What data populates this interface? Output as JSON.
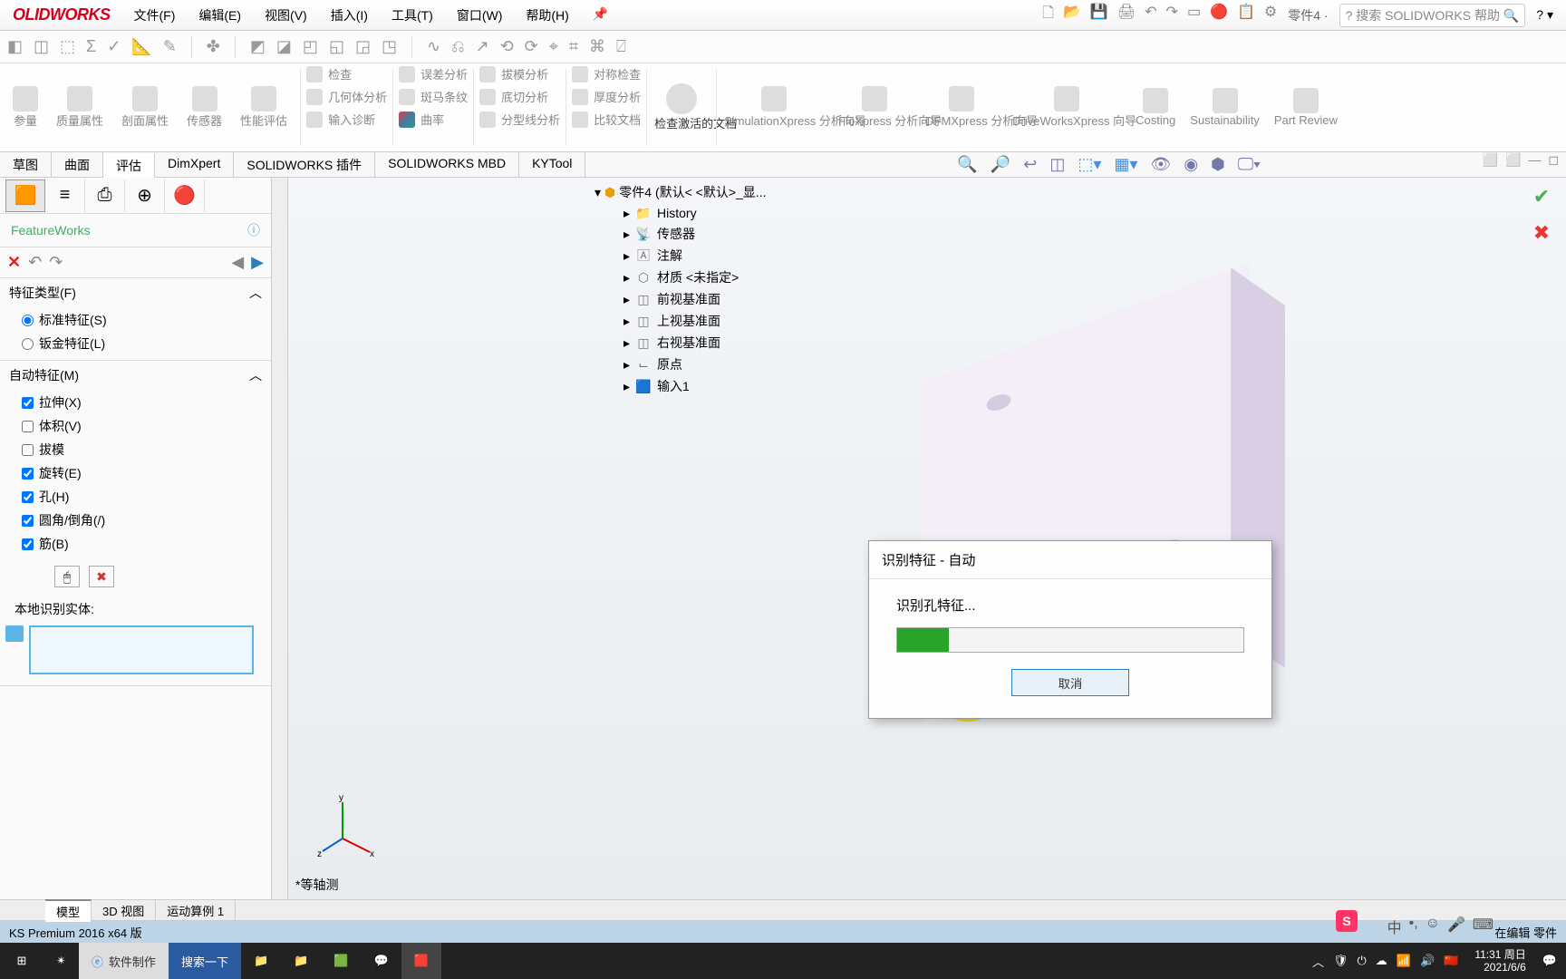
{
  "app": {
    "logo": "OLIDWORKS",
    "doc_name": "零件4 ·"
  },
  "menubar": {
    "items": [
      "文件(F)",
      "编辑(E)",
      "视图(V)",
      "插入(I)",
      "工具(T)",
      "窗口(W)",
      "帮助(H)"
    ],
    "pin": "📌",
    "search_placeholder": "搜索 SOLIDWORKS 帮助",
    "help_prefix": "?"
  },
  "ribbon": {
    "group_small_buttons": [
      "参量",
      "质量属性",
      "剖面属性",
      "传感器",
      "性能评估"
    ],
    "group_right_col": [
      {
        "label": "检查"
      },
      {
        "label": "几何体分析"
      },
      {
        "label": "输入诊断"
      }
    ],
    "group_mid": [
      {
        "label": "误差分析"
      },
      {
        "label": "斑马条纹"
      },
      {
        "label": "曲率"
      }
    ],
    "group_mid2": [
      {
        "label": "拔模分析"
      },
      {
        "label": "底切分析"
      },
      {
        "label": "分型线分析"
      }
    ],
    "group_mid3": [
      {
        "label": "对称检查"
      },
      {
        "label": "厚度分析"
      },
      {
        "label": "比较文档"
      }
    ],
    "activate": {
      "label": "检查激活的文档"
    },
    "xpress": [
      {
        "label": "SimulationXpress 分析向导"
      },
      {
        "label": "FloXpress 分析向导"
      },
      {
        "label": "DFMXpress 分析向导"
      },
      {
        "label": "DriveWorksXpress 向导"
      },
      {
        "label": "Costing"
      },
      {
        "label": "Sustainability"
      },
      {
        "label": "Part Review"
      }
    ]
  },
  "ribbon_tabs": [
    "草图",
    "曲面",
    "评估",
    "DimXpert",
    "SOLIDWORKS 插件",
    "SOLIDWORKS MBD",
    "KYTool"
  ],
  "left": {
    "title": "FeatureWorks",
    "sections": {
      "type": {
        "header": "特征类型(F)",
        "options": [
          "标准特征(S)",
          "钣金特征(L)"
        ]
      },
      "auto": {
        "header": "自动特征(M)",
        "checks": [
          {
            "label": "拉伸(X)",
            "checked": true
          },
          {
            "label": "体积(V)",
            "checked": false
          },
          {
            "label": "拔模",
            "checked": false
          },
          {
            "label": "旋转(E)",
            "checked": true
          },
          {
            "label": "孔(H)",
            "checked": true
          },
          {
            "label": "圆角/倒角(/)",
            "checked": true
          },
          {
            "label": "筋(B)",
            "checked": true
          }
        ]
      }
    },
    "local_label": "本地识别实体:"
  },
  "tree": {
    "root": "零件4  (默认< <默认>_显...",
    "items": [
      "History",
      "传感器",
      "注解",
      "材质 <未指定>",
      "前视基准面",
      "上视基准面",
      "右视基准面",
      "原点",
      "输入1"
    ]
  },
  "dialog": {
    "title": "识别特征 - 自动",
    "message": "识别孔特征...",
    "progress_percent": 15,
    "cancel": "取消"
  },
  "view": {
    "label": "*等轴测"
  },
  "model_tabs": [
    "模型",
    "3D 视图",
    "运动算例 1"
  ],
  "status": {
    "left": "KS Premium 2016 x64 版",
    "right": "在编辑 零件"
  },
  "taskbar": {
    "browser": "软件制作",
    "search": "搜索一下",
    "time": "11:31 周日",
    "date": "2021/6/6",
    "ime": "中"
  }
}
